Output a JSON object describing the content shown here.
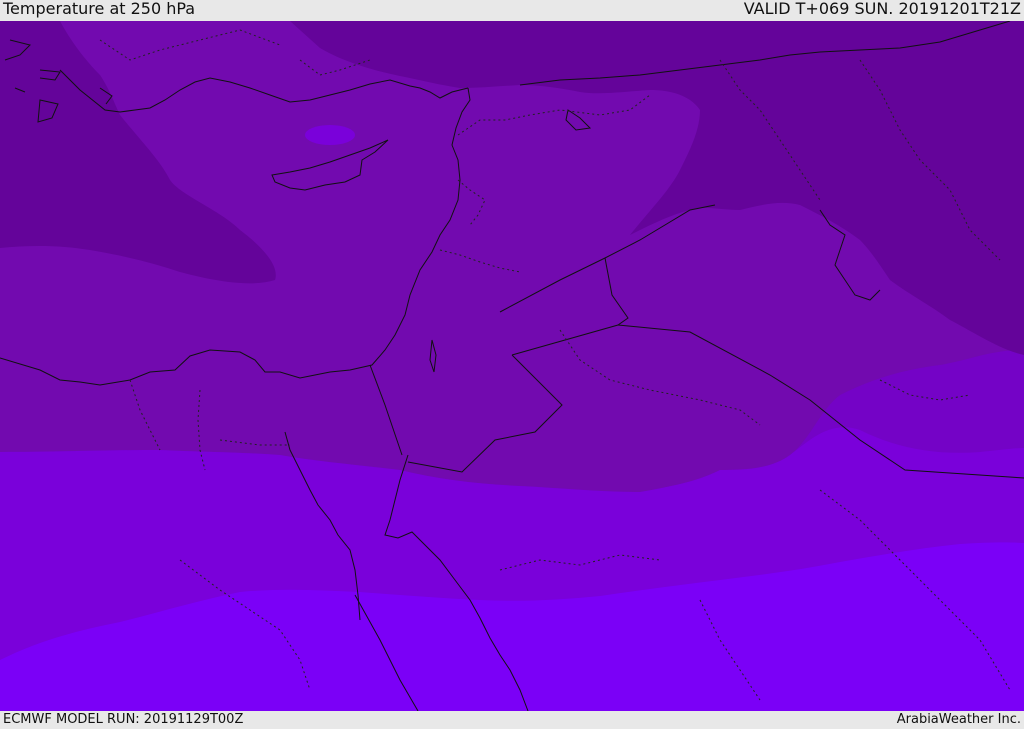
{
  "header": {
    "title": "Temperature at 250 hPa",
    "valid": "VALID T+069 SUN. 20191201T21Z"
  },
  "footer": {
    "model_run": "ECMWF MODEL RUN: 20191129T00Z",
    "credit": "ArabiaWeather Inc."
  },
  "map": {
    "region": "Eastern Mediterranean and Middle East",
    "colors": {
      "coldest": "#64049a",
      "cold": "#720aaf",
      "mid": "#7403c6",
      "warm": "#7a01da",
      "warmest": "#7b00f7",
      "coastline": "#111111"
    }
  }
}
